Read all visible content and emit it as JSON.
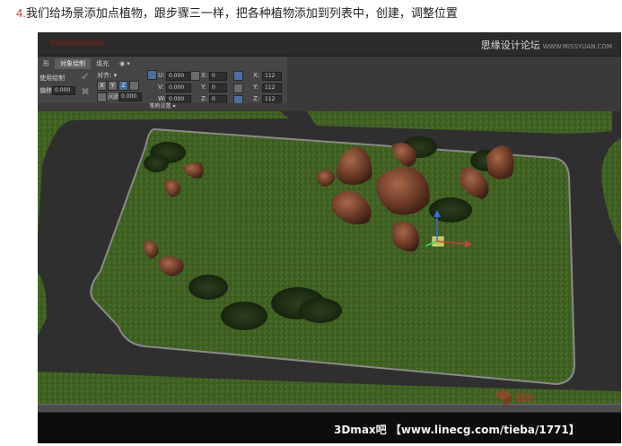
{
  "caption": {
    "number": "4.",
    "text": "我们给场景添加点植物，跟步骤三一样，把各种植物添加到列表中，创建，调整位置"
  },
  "watermark": {
    "text": "思缘设计论坛",
    "url": "WWW.MISSYUAN.COM"
  },
  "ribbon": {
    "tabs": [
      {
        "label": "形",
        "active": false
      },
      {
        "label": "对象绘制",
        "active": true
      },
      {
        "label": "填充",
        "active": false
      },
      {
        "label": "◉ ▾",
        "active": false
      }
    ],
    "left_labels": [
      "使用绘制",
      "偏移:"
    ],
    "offset_value": "0.000",
    "align_label": "对齐: ▾",
    "axis_buttons": [
      "X",
      "Y",
      "Z"
    ],
    "spacing_label": "间距:",
    "spacing_value": "0.000",
    "uvw_fields": [
      {
        "label": "U:",
        "value": "0.000"
      },
      {
        "label": "V:",
        "value": "0.000"
      },
      {
        "label": "W:",
        "value": "0.000"
      }
    ],
    "xyz_fields": [
      {
        "label": "X:",
        "value": "0"
      },
      {
        "label": "Y:",
        "value": "0"
      },
      {
        "label": "Z:",
        "value": "0"
      }
    ],
    "scale_fields": [
      {
        "label": "X:",
        "value": "112"
      },
      {
        "label": "Y:",
        "value": "112"
      },
      {
        "label": "Z:",
        "value": "112"
      }
    ],
    "footer_label": "笔刷设置 ▾"
  },
  "footer": {
    "text": "3Dmax吧 【www.linecg.com/tieba/1771】"
  },
  "colors": {
    "grass": "#3f5f22",
    "road": "#2f2f2f",
    "curb": "#8a8a8a",
    "rock": "#6b3a26",
    "ui_panel": "#454545"
  }
}
